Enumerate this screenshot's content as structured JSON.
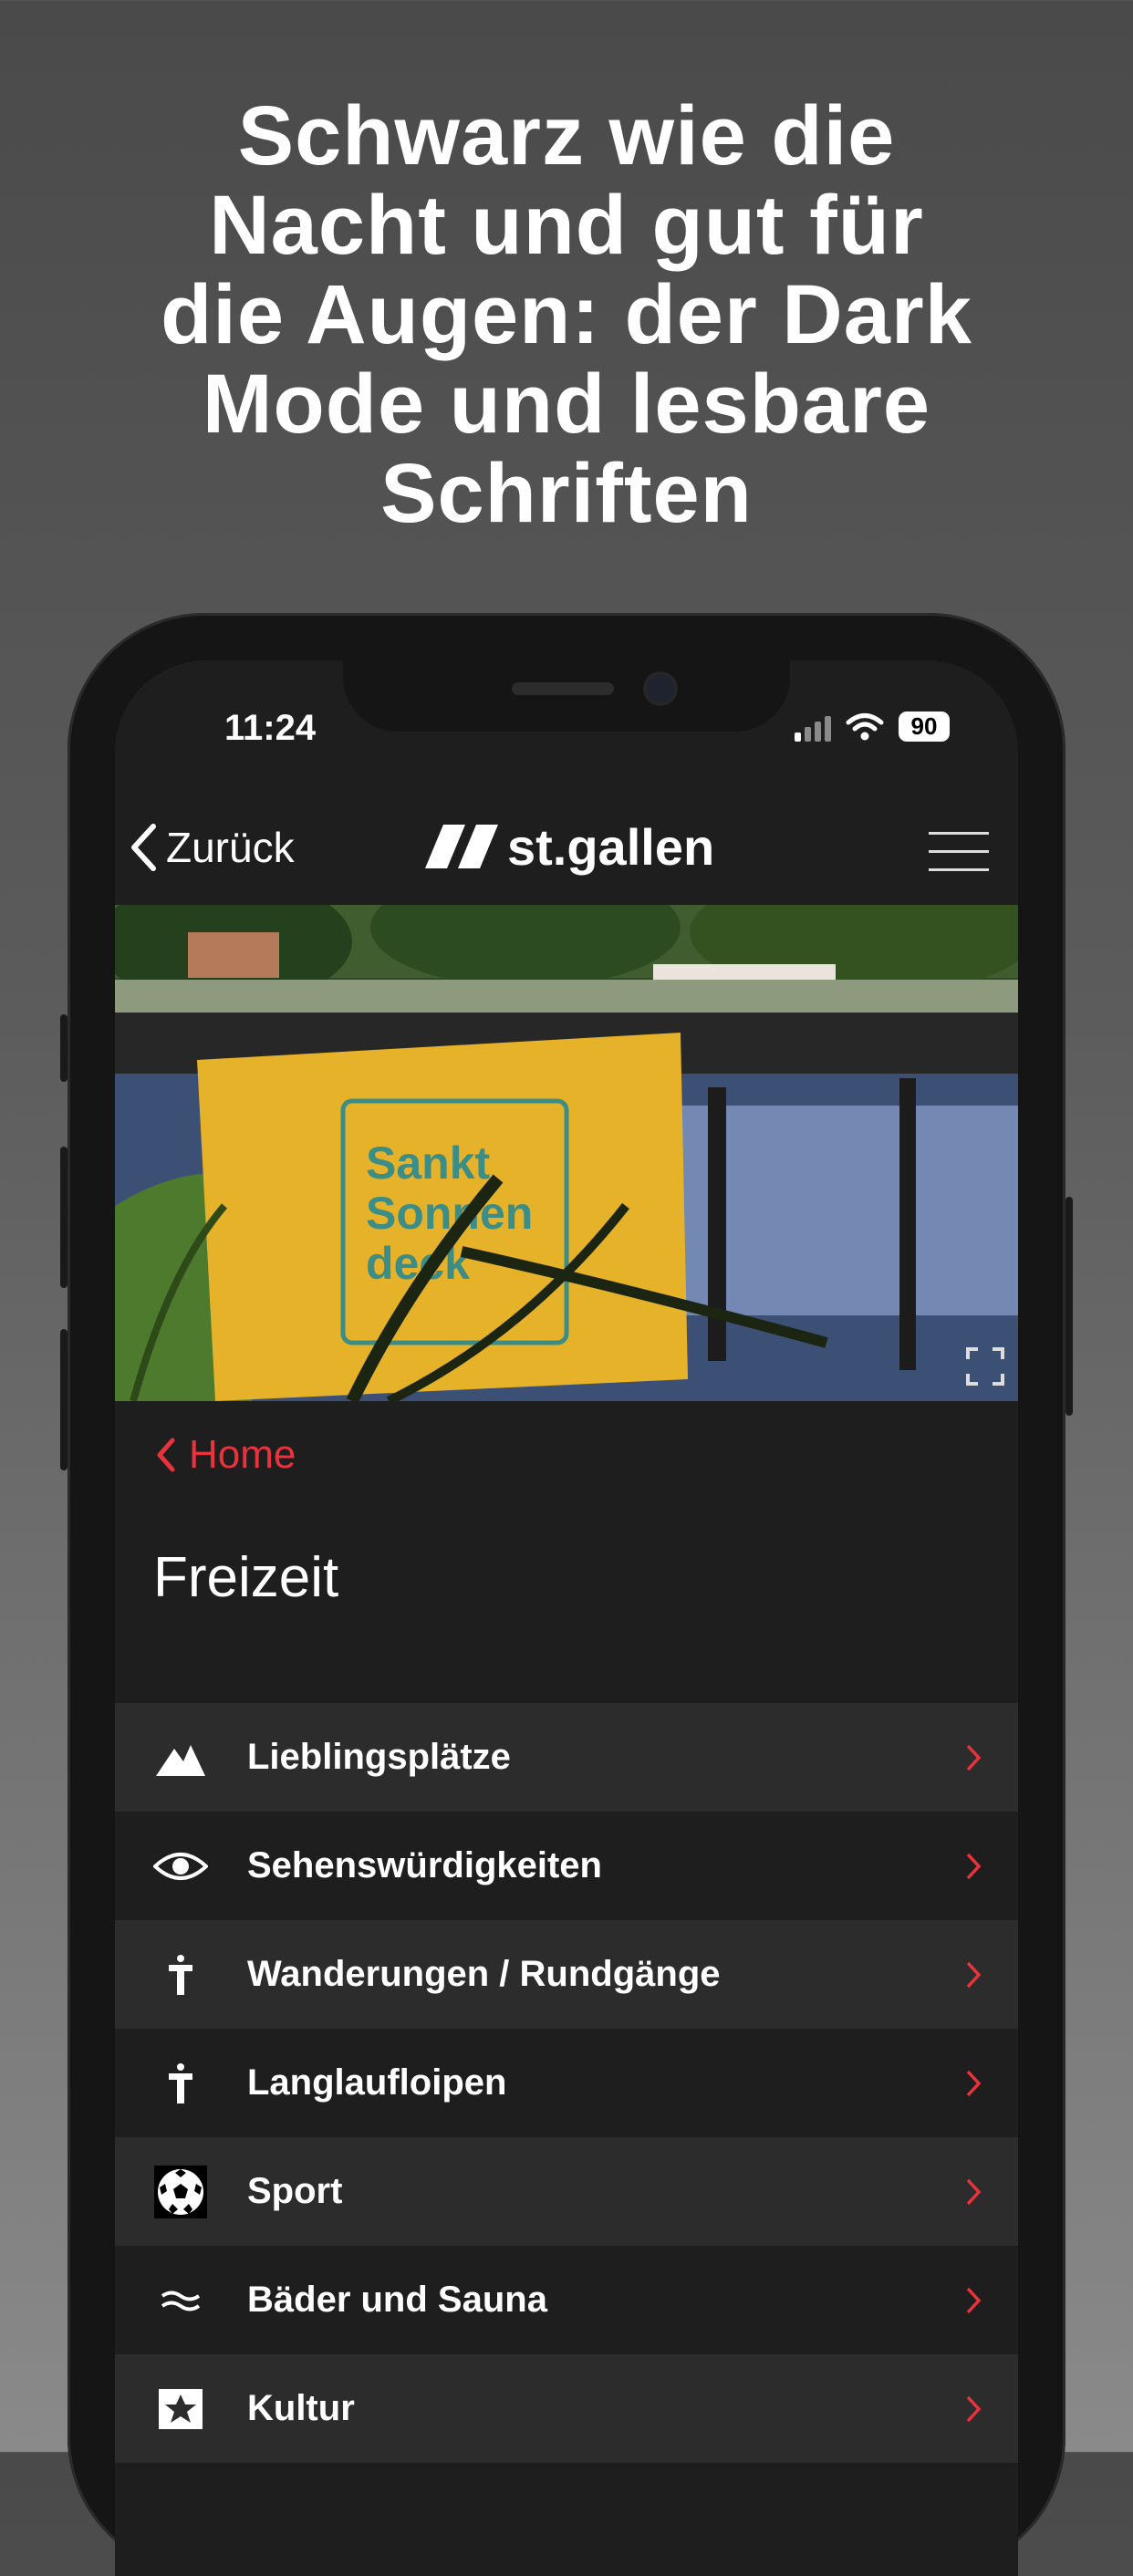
{
  "headline": {
    "line1": "Schwarz wie die",
    "line2": "Nacht und gut für",
    "line3": "die Augen: der Dark",
    "line4": "Mode und lesbare",
    "line5": "Schriften"
  },
  "status_bar": {
    "time": "11:24",
    "battery": "90"
  },
  "nav": {
    "back_label": "Zurück",
    "logo_text": "st.gallen"
  },
  "hero_image": {
    "alt": "Sankt Sonnendeck",
    "towel_text": [
      "Sankt",
      "Sonnen",
      "deck"
    ]
  },
  "breadcrumb": {
    "label": "Home"
  },
  "page_title": "Freizeit",
  "list_items": [
    {
      "label": "Lieblingsplätze",
      "icon": "mountain-icon"
    },
    {
      "label": "Sehenswürdigkeiten",
      "icon": "eye-icon"
    },
    {
      "label": "Wanderungen / Rundgänge",
      "icon": "signpost-icon"
    },
    {
      "label": "Langlaufloipen",
      "icon": "signpost-icon"
    },
    {
      "label": "Sport",
      "icon": "soccer-ball-icon"
    },
    {
      "label": "Bäder und Sauna",
      "icon": "waves-icon"
    },
    {
      "label": "Kultur",
      "icon": "theater-icon"
    }
  ],
  "colors": {
    "accent": "#e8323c",
    "background": "#1e1e1f",
    "row_alt": "#2c2c2d",
    "towel": "#e6b22a"
  }
}
